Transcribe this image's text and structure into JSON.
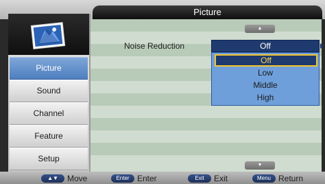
{
  "header": {
    "title": "Picture"
  },
  "sidebar": {
    "logo_icon": "photo-frames-icon",
    "items": [
      {
        "label": "Picture",
        "active": true
      },
      {
        "label": "Sound",
        "active": false
      },
      {
        "label": "Channel",
        "active": false
      },
      {
        "label": "Feature",
        "active": false
      },
      {
        "label": "Setup",
        "active": false
      }
    ]
  },
  "content": {
    "setting": {
      "label": "Noise Reduction",
      "value": "Off"
    },
    "dropdown": {
      "options": [
        "Off",
        "Low",
        "Middle",
        "High"
      ],
      "selected": "Off"
    },
    "scroll_up_glyph": "▲",
    "scroll_down_glyph": "▼"
  },
  "footer": {
    "hints": [
      {
        "key": "▲▼",
        "label": "Move"
      },
      {
        "key": "Enter",
        "label": "Enter"
      },
      {
        "key": "Exit",
        "label": "Exit"
      },
      {
        "key": "Menu",
        "label": "Return"
      }
    ]
  },
  "colors": {
    "accent_blue": "#4f7fc0",
    "selected_text": "#ffd84a",
    "dropdown_bg": "#6f9fdb"
  }
}
